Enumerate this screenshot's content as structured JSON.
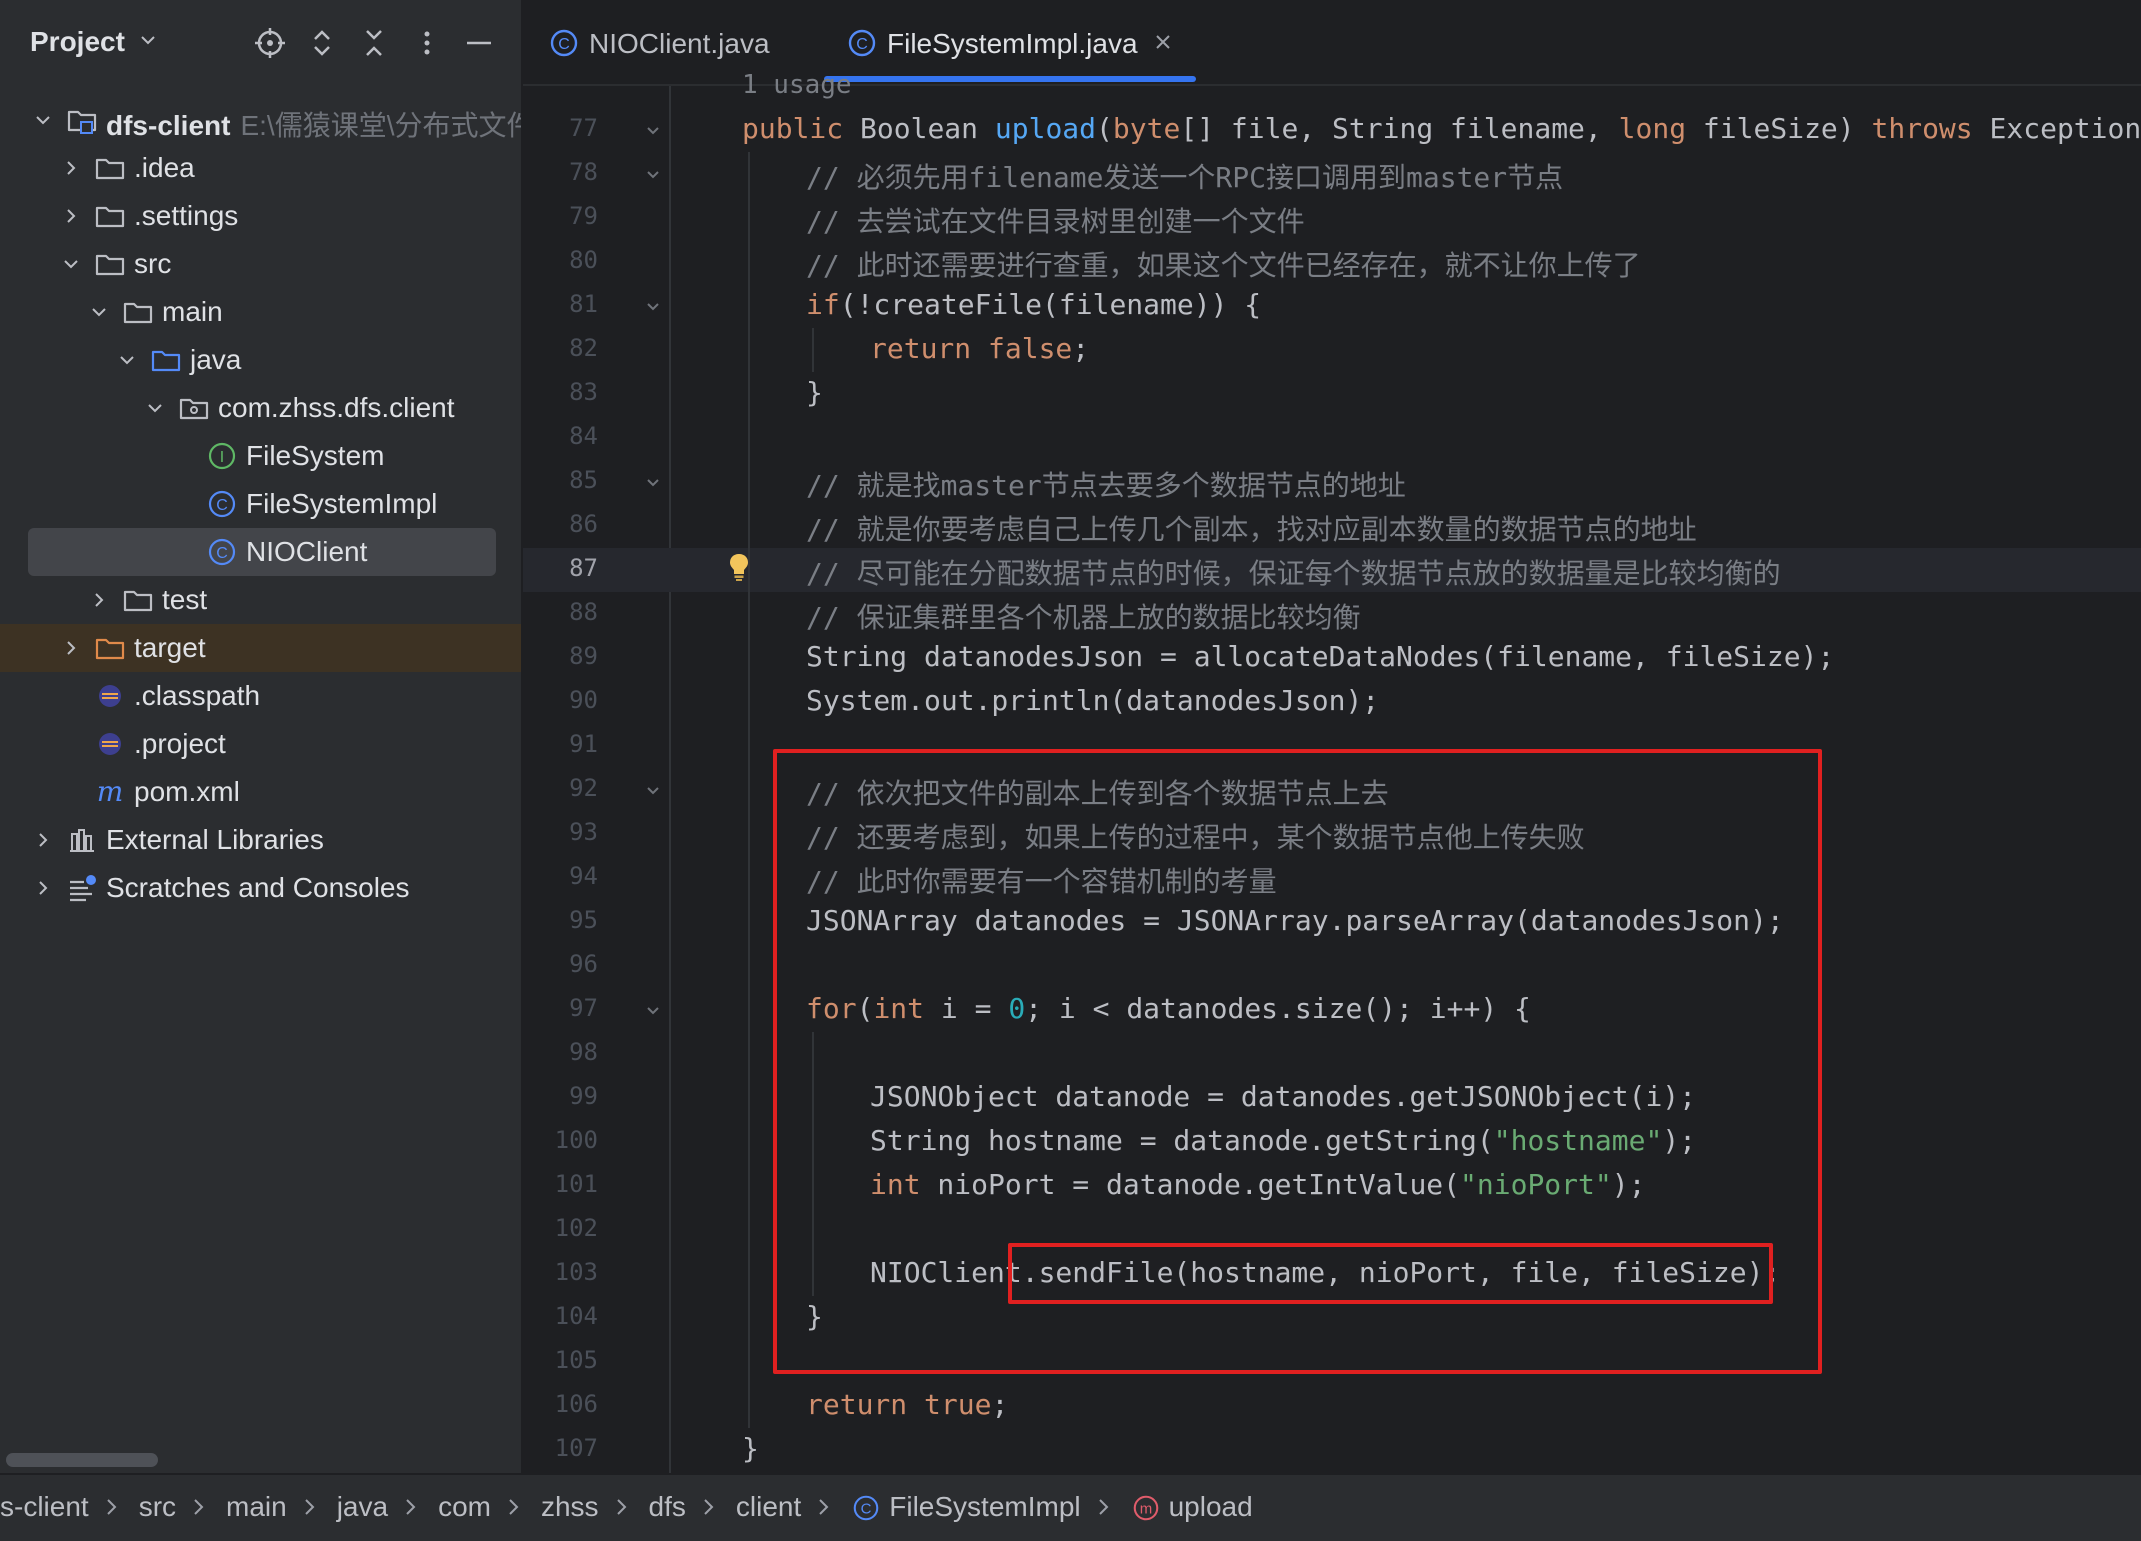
{
  "sidebar": {
    "title": "Project",
    "tree": [
      {
        "label": "dfs-client",
        "hint": "E:\\儒猿课堂\\分布式文件",
        "icon": "module-folder-icon",
        "depth": 0,
        "expanded": true,
        "bold": true
      },
      {
        "label": ".idea",
        "icon": "folder-icon",
        "depth": 1,
        "expanded": false
      },
      {
        "label": ".settings",
        "icon": "folder-icon",
        "depth": 1,
        "expanded": false
      },
      {
        "label": "src",
        "icon": "folder-icon",
        "depth": 1,
        "expanded": true
      },
      {
        "label": "main",
        "icon": "folder-icon",
        "depth": 2,
        "expanded": true
      },
      {
        "label": "java",
        "icon": "source-folder-icon",
        "depth": 3,
        "expanded": true
      },
      {
        "label": "com.zhss.dfs.client",
        "icon": "package-icon",
        "depth": 4,
        "expanded": true
      },
      {
        "label": "FileSystem",
        "icon": "interface-icon",
        "depth": 5
      },
      {
        "label": "FileSystemImpl",
        "icon": "class-icon",
        "depth": 5
      },
      {
        "label": "NIOClient",
        "icon": "class-icon",
        "depth": 5,
        "selected": true
      },
      {
        "label": "test",
        "icon": "folder-icon",
        "depth": 2,
        "expanded": false
      },
      {
        "label": "target",
        "icon": "excluded-folder-icon",
        "depth": 1,
        "expanded": false,
        "excluded": true
      },
      {
        "label": ".classpath",
        "icon": "eclipse-file-icon",
        "depth": 1
      },
      {
        "label": ".project",
        "icon": "eclipse-file-icon",
        "depth": 1
      },
      {
        "label": "pom.xml",
        "icon": "maven-icon",
        "depth": 1
      },
      {
        "label": "External Libraries",
        "icon": "libraries-icon",
        "depth": 0,
        "expanded": false
      },
      {
        "label": "Scratches and Consoles",
        "icon": "scratches-icon",
        "depth": 0,
        "expanded": false
      }
    ]
  },
  "tabs": [
    {
      "label": "NIOClient.java",
      "icon": "class-icon",
      "active": false
    },
    {
      "label": "FileSystemImpl.java",
      "icon": "class-icon",
      "active": true
    }
  ],
  "editor": {
    "usage_hint": "1 usage",
    "current_line": 87,
    "lines": [
      {
        "n": "77",
        "fold": true,
        "indent": 0,
        "tokens": [
          [
            "kw",
            "public "
          ],
          [
            "",
            "Boolean "
          ],
          [
            "fn",
            "upload"
          ],
          [
            "",
            "("
          ],
          [
            "kw",
            "byte"
          ],
          [
            "",
            "[] file, String filename, "
          ],
          [
            "kw",
            "long"
          ],
          [
            "",
            " fileSize) "
          ],
          [
            "kw",
            "throws"
          ],
          [
            "",
            " Exception {"
          ]
        ]
      },
      {
        "n": "78",
        "fold": true,
        "indent": 1,
        "tokens": [
          [
            "cm",
            "// 必须先用filename发送一个RPC接口调用到master节点"
          ]
        ]
      },
      {
        "n": "79",
        "indent": 1,
        "tokens": [
          [
            "cm",
            "// 去尝试在文件目录树里创建一个文件"
          ]
        ]
      },
      {
        "n": "80",
        "indent": 1,
        "tokens": [
          [
            "cm",
            "// 此时还需要进行查重，如果这个文件已经存在，就不让你上传了"
          ]
        ]
      },
      {
        "n": "81",
        "fold": true,
        "indent": 1,
        "tokens": [
          [
            "kw",
            "if"
          ],
          [
            "",
            "(!createFile(filename)) {"
          ]
        ]
      },
      {
        "n": "82",
        "indent": 2,
        "tokens": [
          [
            "kw",
            "return false"
          ],
          [
            "",
            ";"
          ]
        ]
      },
      {
        "n": "83",
        "indent": 1,
        "tokens": [
          [
            "",
            "}"
          ]
        ]
      },
      {
        "n": "84",
        "indent": 1,
        "tokens": []
      },
      {
        "n": "85",
        "fold": true,
        "indent": 1,
        "tokens": [
          [
            "cm",
            "// 就是找master节点去要多个数据节点的地址"
          ]
        ]
      },
      {
        "n": "86",
        "indent": 1,
        "tokens": [
          [
            "cm",
            "// 就是你要考虑自己上传几个副本，找对应副本数量的数据节点的地址"
          ]
        ]
      },
      {
        "n": "87",
        "indent": 1,
        "tokens": [
          [
            "cm",
            "// 尽可能在分配数据节点的时候，保证每个数据节点放的数据量是比较均衡的"
          ]
        ]
      },
      {
        "n": "88",
        "indent": 1,
        "tokens": [
          [
            "cm",
            "// 保证集群里各个机器上放的数据比较均衡"
          ]
        ]
      },
      {
        "n": "89",
        "indent": 1,
        "tokens": [
          [
            "",
            "String datanodesJson = allocateDataNodes(filename, fileSize);"
          ]
        ]
      },
      {
        "n": "90",
        "indent": 1,
        "tokens": [
          [
            "",
            "System.out.println(datanodesJson);"
          ]
        ]
      },
      {
        "n": "91",
        "indent": 1,
        "tokens": []
      },
      {
        "n": "92",
        "fold": true,
        "indent": 1,
        "tokens": [
          [
            "cm",
            "// 依次把文件的副本上传到各个数据节点上去"
          ]
        ]
      },
      {
        "n": "93",
        "indent": 1,
        "tokens": [
          [
            "cm",
            "// 还要考虑到，如果上传的过程中，某个数据节点他上传失败"
          ]
        ]
      },
      {
        "n": "94",
        "indent": 1,
        "tokens": [
          [
            "cm",
            "// 此时你需要有一个容错机制的考量"
          ]
        ]
      },
      {
        "n": "95",
        "indent": 1,
        "tokens": [
          [
            "",
            "JSONArray datanodes = JSONArray.parseArray(datanodesJson);"
          ]
        ]
      },
      {
        "n": "96",
        "indent": 1,
        "tokens": []
      },
      {
        "n": "97",
        "fold": true,
        "indent": 1,
        "tokens": [
          [
            "kw",
            "for"
          ],
          [
            "",
            "("
          ],
          [
            "kw",
            "int"
          ],
          [
            "",
            " i = "
          ],
          [
            "num",
            "0"
          ],
          [
            "",
            "; i < datanodes.size(); i++) {"
          ]
        ]
      },
      {
        "n": "98",
        "indent": 2,
        "tokens": []
      },
      {
        "n": "99",
        "indent": 2,
        "tokens": [
          [
            "",
            "JSONObject datanode = datanodes.getJSONObject(i);"
          ]
        ]
      },
      {
        "n": "100",
        "indent": 2,
        "tokens": [
          [
            "",
            "String hostname = datanode.getString("
          ],
          [
            "str",
            "\"hostname\""
          ],
          [
            "",
            ");"
          ]
        ]
      },
      {
        "n": "101",
        "indent": 2,
        "tokens": [
          [
            "kw",
            "int"
          ],
          [
            "",
            " nioPort = datanode.getIntValue("
          ],
          [
            "str",
            "\"nioPort\""
          ],
          [
            "",
            ");"
          ]
        ]
      },
      {
        "n": "102",
        "indent": 2,
        "tokens": []
      },
      {
        "n": "103",
        "indent": 2,
        "tokens": [
          [
            "",
            "NIOClient.sendFile(hostname, nioPort, file, fileSize);"
          ]
        ]
      },
      {
        "n": "104",
        "indent": 1,
        "tokens": [
          [
            "",
            "}"
          ]
        ]
      },
      {
        "n": "105",
        "indent": 1,
        "tokens": []
      },
      {
        "n": "106",
        "indent": 1,
        "tokens": [
          [
            "kw",
            "return true"
          ],
          [
            "",
            ";"
          ]
        ]
      },
      {
        "n": "107",
        "indent": 0,
        "tokens": [
          [
            "",
            "}"
          ]
        ]
      }
    ]
  },
  "breadcrumb": [
    {
      "label": "s-client"
    },
    {
      "label": "src"
    },
    {
      "label": "main"
    },
    {
      "label": "java"
    },
    {
      "label": "com"
    },
    {
      "label": "zhss"
    },
    {
      "label": "dfs"
    },
    {
      "label": "client"
    },
    {
      "label": "FileSystemImpl",
      "icon": "class-icon"
    },
    {
      "label": "upload",
      "icon": "method-icon"
    }
  ],
  "colors": {
    "accent": "#3574f0",
    "highlight_box": "#e02020",
    "keyword": "#cf8e6d",
    "comment": "#7a7e85",
    "string": "#6aab73",
    "number": "#2aacb8"
  }
}
